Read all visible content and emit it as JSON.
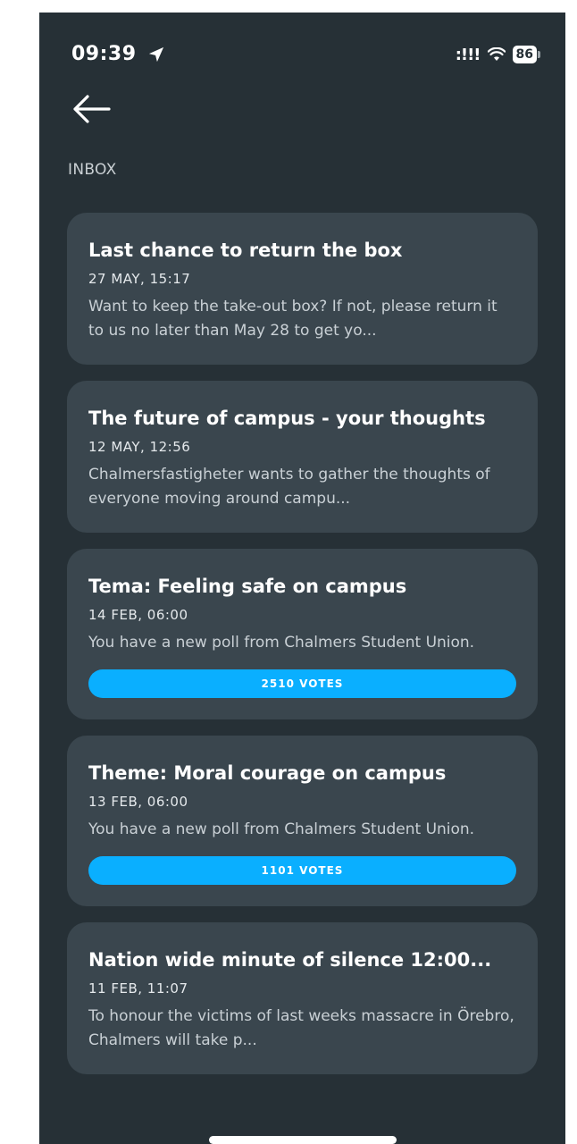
{
  "status_bar": {
    "time": "09:39",
    "signal": ":!!!",
    "battery": "86"
  },
  "icons": {
    "location": "location-arrow-icon",
    "wifi": "wifi-icon",
    "battery": "battery-icon",
    "back": "back-arrow-icon"
  },
  "section_label": "INBOX",
  "messages": [
    {
      "title": "Last chance to return the box",
      "date": "27 MAY, 15:17",
      "preview": "Want to keep the take-out box? If not, please return it to us no later than May 28 to get yo..."
    },
    {
      "title": "The future of campus - your thoughts",
      "date": "12 MAY, 12:56",
      "preview": "Chalmersfastigheter wants to gather the thoughts of everyone moving around campu..."
    },
    {
      "title": "Tema: Feeling safe on campus",
      "date": "14 FEB, 06:00",
      "preview": "You have a new poll from Chalmers Student Union.",
      "votes": "2510 VOTES"
    },
    {
      "title": "Theme: Moral courage on campus",
      "date": "13 FEB, 06:00",
      "preview": "You have a new poll from Chalmers Student Union.",
      "votes": "1101 VOTES"
    },
    {
      "title": "Nation wide minute of silence 12:00...",
      "date": "11 FEB, 11:07",
      "preview": "To honour the victims of last weeks massacre in Örebro, Chalmers will take p..."
    }
  ],
  "colors": {
    "background": "#263036",
    "card": "#3a464e",
    "accent": "#0aafff"
  }
}
